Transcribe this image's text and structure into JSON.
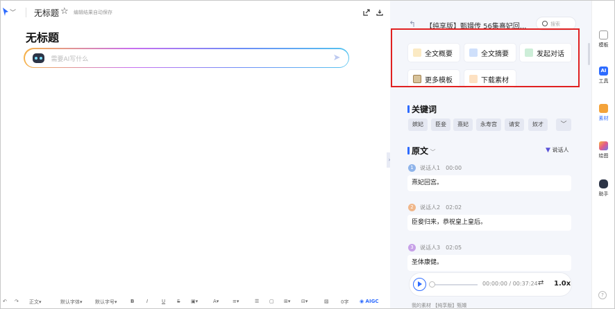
{
  "editor": {
    "doc_title": "无标题",
    "save_tip": "编辑结果自动保存",
    "heading": "无标题",
    "ai_placeholder": "需要AI写什么"
  },
  "bottom_toolbar": {
    "paragraph_style": "正文",
    "font_family": "默认字体",
    "font_size": "默认字号",
    "bold": "B",
    "italic": "I",
    "underline": "U",
    "strikethrough": "S",
    "word_count": "0字",
    "aigc": "AIGC"
  },
  "panel": {
    "title": "【纯享版】甄嬛传 56集熹妃回...",
    "search_label": "搜索",
    "functions": [
      {
        "label": "全文概要",
        "icon": "doc-summary-icon",
        "color": "#f0b040"
      },
      {
        "label": "全文摘要",
        "icon": "doc-extract-icon",
        "color": "#3c7cf0"
      },
      {
        "label": "发起对话",
        "icon": "chat-icon",
        "color": "#3cbf6c"
      },
      {
        "label": "更多模板",
        "icon": "template-icon",
        "color": "#d8a050"
      },
      {
        "label": "下载素材",
        "icon": "download-material-icon",
        "color": "#f08a30"
      }
    ],
    "keywords_title": "关键词",
    "keywords": [
      "嫔妃",
      "臣妾",
      "熹妃",
      "永寿宫",
      "请安",
      "奴才"
    ],
    "transcript_title": "原文",
    "speaker_filter": "说话人",
    "entries": [
      {
        "num": "1",
        "speaker": "说话人1",
        "time": "00:00",
        "text": "熹妃回宫。",
        "color": "#8fb4ea"
      },
      {
        "num": "2",
        "speaker": "说话人2",
        "time": "02:02",
        "text": "臣妾归来，恭祝皇上皇后。",
        "color": "#f0b78a"
      },
      {
        "num": "3",
        "speaker": "说话人3",
        "time": "02:05",
        "text": "圣体康健。",
        "color": "#c7a1e8"
      }
    ],
    "player": {
      "current": "00:00:00",
      "total": "00:37:24",
      "time_text": "00:00:00 / 00:37:24",
      "speed": "1.0x",
      "progress": 0
    },
    "bottom_peek": "我的素材   【纯享版】甄嬛"
  },
  "sidebar": [
    {
      "label": "模板",
      "icon": "template-side-icon"
    },
    {
      "label": "工具",
      "icon": "ai-tool-icon"
    },
    {
      "label": "素材",
      "icon": "folder-icon"
    },
    {
      "label": "绘图",
      "icon": "drawing-icon"
    },
    {
      "label": "助手",
      "icon": "assistant-icon"
    }
  ],
  "colors": {
    "accent": "#2d6bff",
    "highlight_border": "#e02020",
    "panel_bg": "#f4f6fb"
  }
}
